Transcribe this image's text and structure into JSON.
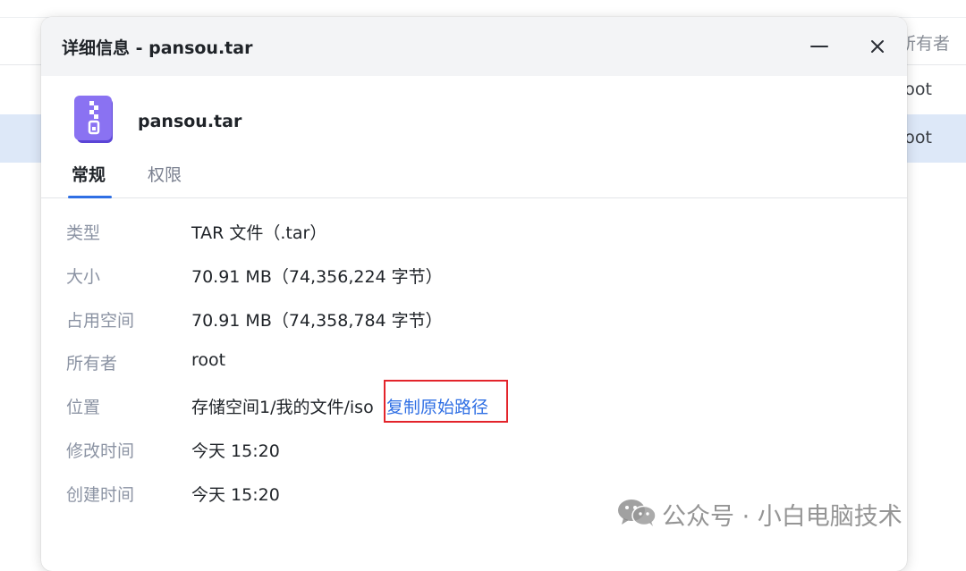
{
  "background": {
    "column_header_owner": "所有者",
    "rows": [
      {
        "owner": "root"
      },
      {
        "owner": "root"
      }
    ]
  },
  "dialog": {
    "title": "详细信息 - pansou.tar",
    "minimize_icon": "minimize-icon",
    "close_icon": "close-icon",
    "file": {
      "icon": "archive-file-icon",
      "name": "pansou.tar"
    },
    "tabs": [
      {
        "label": "常规",
        "active": true
      },
      {
        "label": "权限",
        "active": false
      }
    ],
    "properties": [
      {
        "label": "类型",
        "value": "TAR 文件（.tar）"
      },
      {
        "label": "大小",
        "value": "70.91 MB（74,356,224 字节）"
      },
      {
        "label": "占用空间",
        "value": "70.91 MB（74,358,784 字节）"
      },
      {
        "label": "所有者",
        "value": "root"
      },
      {
        "label": "位置",
        "value": "存储空间1/我的文件/iso",
        "action": "复制原始路径"
      },
      {
        "label": "修改时间",
        "value": "今天 15:20"
      },
      {
        "label": "创建时间",
        "value": "今天 15:20"
      }
    ],
    "accent_color": "#2f6fe4",
    "highlight_color": "#e3242b"
  },
  "watermark": {
    "logo": "wechat-logo",
    "text": "公众号 · 小白电脑技术"
  }
}
